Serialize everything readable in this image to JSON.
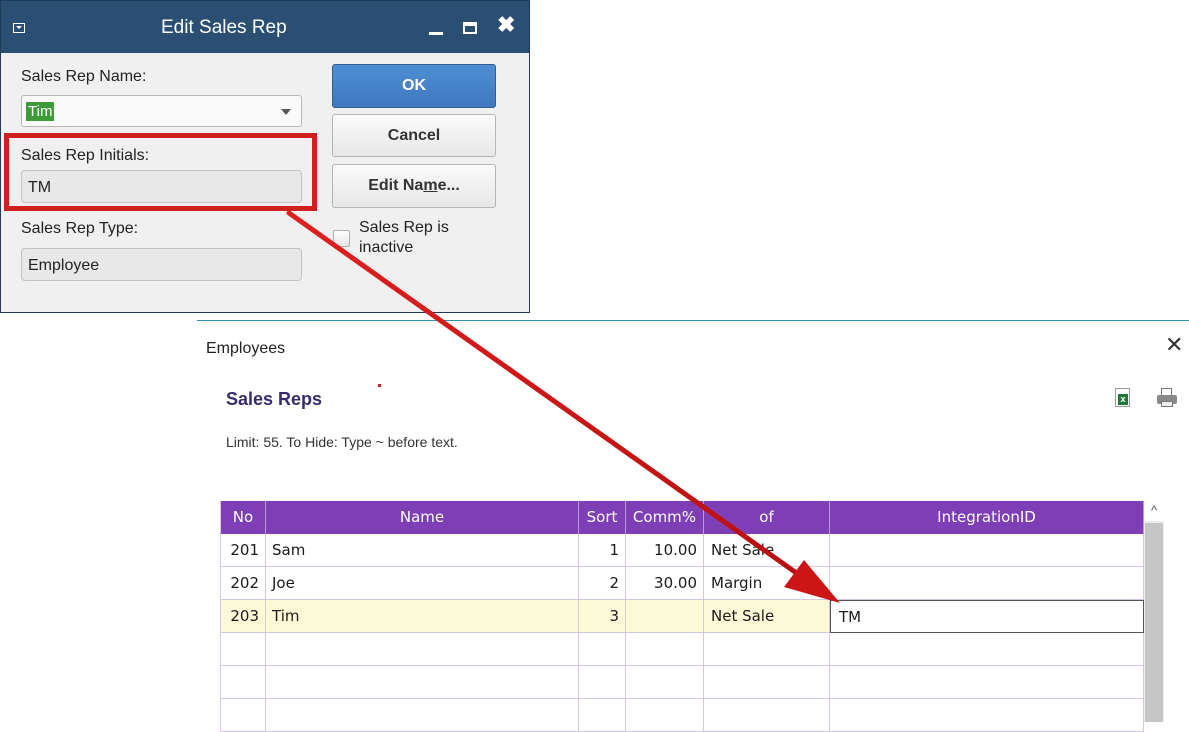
{
  "dialog": {
    "title": "Edit Sales Rep",
    "name_label": "Sales Rep Name:",
    "name_value": "Tim",
    "initials_label": "Sales Rep Initials:",
    "initials_value": "TM",
    "type_label": "Sales Rep Type:",
    "type_value": "Employee",
    "ok_label": "OK",
    "cancel_label": "Cancel",
    "edit_name_label": "Edit Name...",
    "inactive_label": "Sales Rep is inactive",
    "inactive_checked": false
  },
  "employees": {
    "window_title": "Employees",
    "heading": "Sales Reps",
    "limit_text": "Limit: 55. To Hide: Type ~ before text.",
    "columns": [
      "No",
      "Name",
      "Sort",
      "Comm%",
      "of",
      "IntegrationID"
    ],
    "rows": [
      [
        "201",
        "Sam",
        "1",
        "10.00",
        "Net Sale",
        ""
      ],
      [
        "202",
        "Joe",
        "2",
        "30.00",
        "Margin",
        ""
      ],
      [
        "203",
        "Tim",
        "3",
        "",
        "Net Sale",
        "TM"
      ],
      [
        "",
        "",
        "",
        "",
        "",
        ""
      ],
      [
        "",
        "",
        "",
        "",
        "",
        ""
      ],
      [
        "",
        "",
        "",
        "",
        "",
        ""
      ]
    ],
    "selected_row": 2,
    "header_color": "#7e3eb6"
  },
  "annotation": {
    "color": "#d11f1f"
  },
  "icons": {
    "export": "excel-export-icon",
    "print": "print-icon",
    "close": "close-icon"
  }
}
